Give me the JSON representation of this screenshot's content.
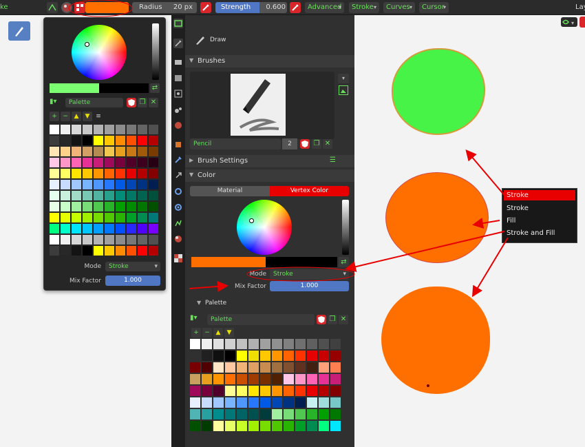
{
  "topbar": {
    "left_fragment": "ke",
    "color_preview_hex": "#ff6f00",
    "radius_label": "Radius",
    "radius_value": "20 px",
    "strength_label": "Strength",
    "strength_value": "0.600",
    "menus": [
      "Advanced",
      "Stroke",
      "Curves",
      "Cursor"
    ],
    "right_fragment": "Lay"
  },
  "popup": {
    "palette_name": "Palette",
    "mode_label": "Mode",
    "mode_value": "Stroke",
    "mix_factor_label": "Mix Factor",
    "mix_factor_value": "1.000",
    "current_color_hex": "#7dff72"
  },
  "props": {
    "tool_label": "Draw",
    "brushes_header": "Brushes",
    "brush_name": "Pencil",
    "brush_users": "2",
    "brush_settings_header": "Brush Settings",
    "color_header": "Color",
    "tab_material": "Material",
    "tab_vertex_color": "Vertex Color",
    "mode_label": "Mode",
    "mode_value": "Stroke",
    "mix_factor_label": "Mix Factor",
    "mix_factor_value": "1.000",
    "palette_header": "Palette",
    "palette_name": "Palette",
    "current_color_hex": "#ff6f00"
  },
  "context_menu": {
    "items": [
      "Stroke",
      "Stroke",
      "Fill",
      "Stroke and Fill"
    ]
  },
  "colors": {
    "accent_red": "#e80000",
    "accent_blue": "#4f77c4",
    "orange": "#ff6f00",
    "green_blob": "#46f346"
  }
}
